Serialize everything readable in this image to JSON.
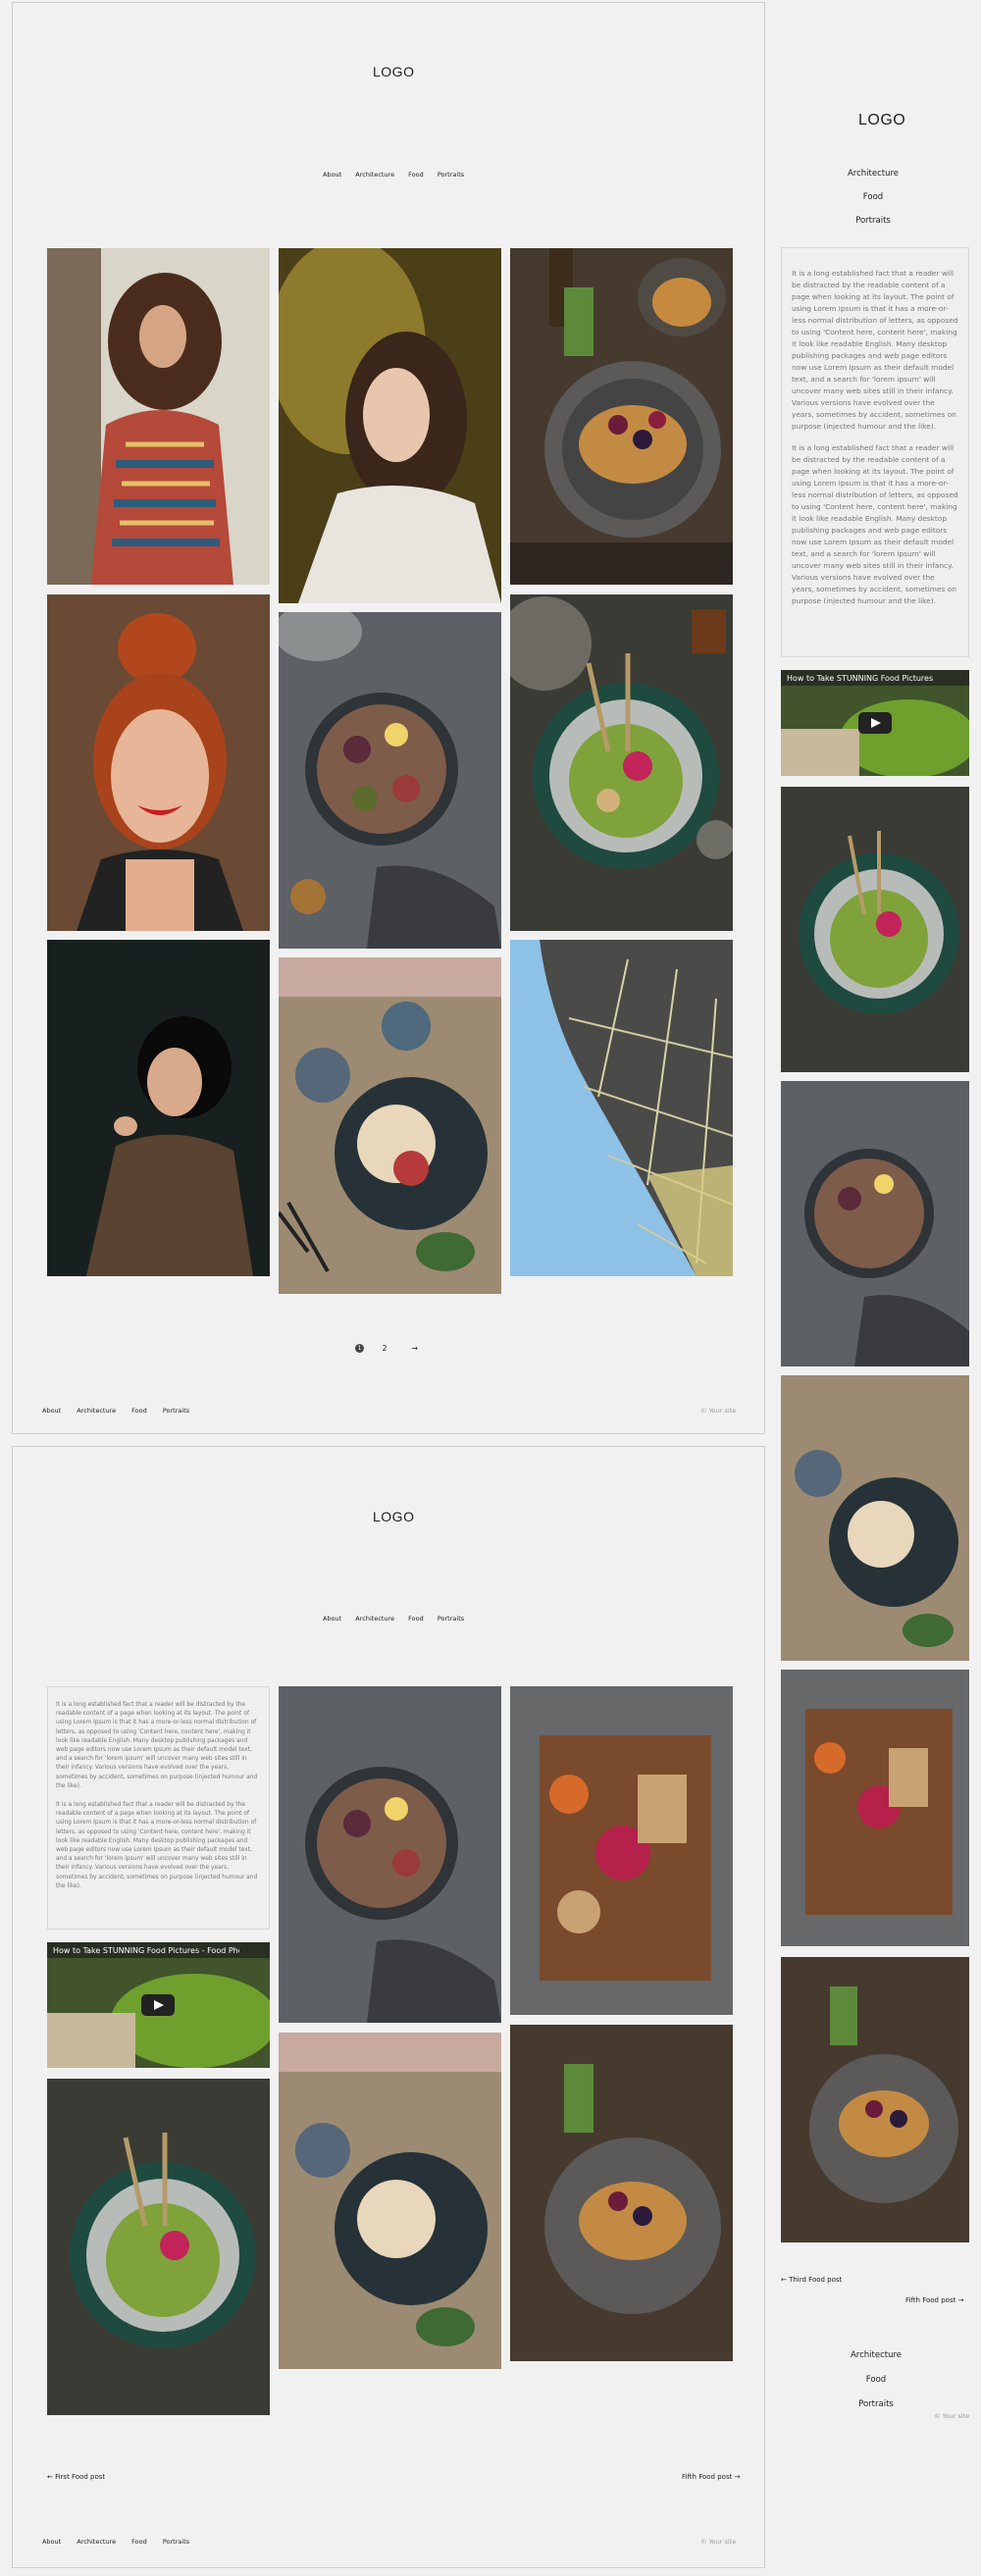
{
  "logo": "LOGO",
  "nav": [
    "About",
    "Architecture",
    "Food",
    "Portraits"
  ],
  "copyright": "© Your site",
  "pagination": {
    "current": "1",
    "next": "2",
    "arrow": "→"
  },
  "lorem": "It is a long established fact that a reader will be distracted by the readable content of a page when looking at its layout. The point of using Lorem Ipsum is that it has a more-or-less normal distribution of letters, as opposed to using 'Content here, content here', making it look like readable English. Many desktop publishing packages and web page editors now use Lorem Ipsum as their default model text, and a search for 'lorem ipsum' will uncover many web sites still in their infancy. Various versions have evolved over the years, sometimes by accident, sometimes on purpose (injected humour and the like).",
  "video_title": "How to Take STUNNING Food Pictures - Food Photogra...",
  "sidebar_nav": [
    "Architecture",
    "Food",
    "Portraits"
  ],
  "post_nav": {
    "side_prev": "← Third Food post",
    "side_next": "Fifth Food post →",
    "bottom_prev": "← First Food post",
    "bottom_next": "Fifth Food post →"
  },
  "colors": {
    "background": "#f1f1f1",
    "border": "#cfcfcf",
    "text": "#222222",
    "muted": "#999999"
  }
}
